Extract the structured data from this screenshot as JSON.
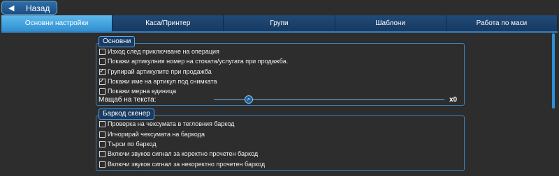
{
  "back": {
    "label": "Назад"
  },
  "tabs": [
    {
      "label": "Основни настройки",
      "active": true
    },
    {
      "label": "Каса/Принтер"
    },
    {
      "label": "Групи"
    },
    {
      "label": "Шаблони"
    },
    {
      "label": "Работа по маси"
    }
  ],
  "main": {
    "title": "Основни",
    "options": [
      {
        "label": "Изход след приключване на операция",
        "checked": false
      },
      {
        "label": "Покажи артикулния номер на стоката/услугата при продажба.",
        "checked": false
      },
      {
        "label": "Групирай артикулите при продажба",
        "checked": true
      },
      {
        "label": "Покажи име на артикул под снимката",
        "checked": true
      },
      {
        "label": "Покажи мерна единица",
        "checked": false
      }
    ],
    "zoom_label": "Мащаб на текста:",
    "zoom_value": "x0"
  },
  "barcode": {
    "title": "Баркод скенер",
    "options": [
      {
        "label": "Проверка на чексумата в тегловния баркод",
        "checked": false
      },
      {
        "label": "Игнорирай чексумата на баркода",
        "checked": false
      },
      {
        "label": "Търси по баркод",
        "checked": false
      },
      {
        "label": "Включи звуков сигнал за коректно прочетен баркод",
        "checked": false
      },
      {
        "label": "Включи звуков сигнал за некоректно прочетен баркод",
        "checked": false
      }
    ]
  }
}
